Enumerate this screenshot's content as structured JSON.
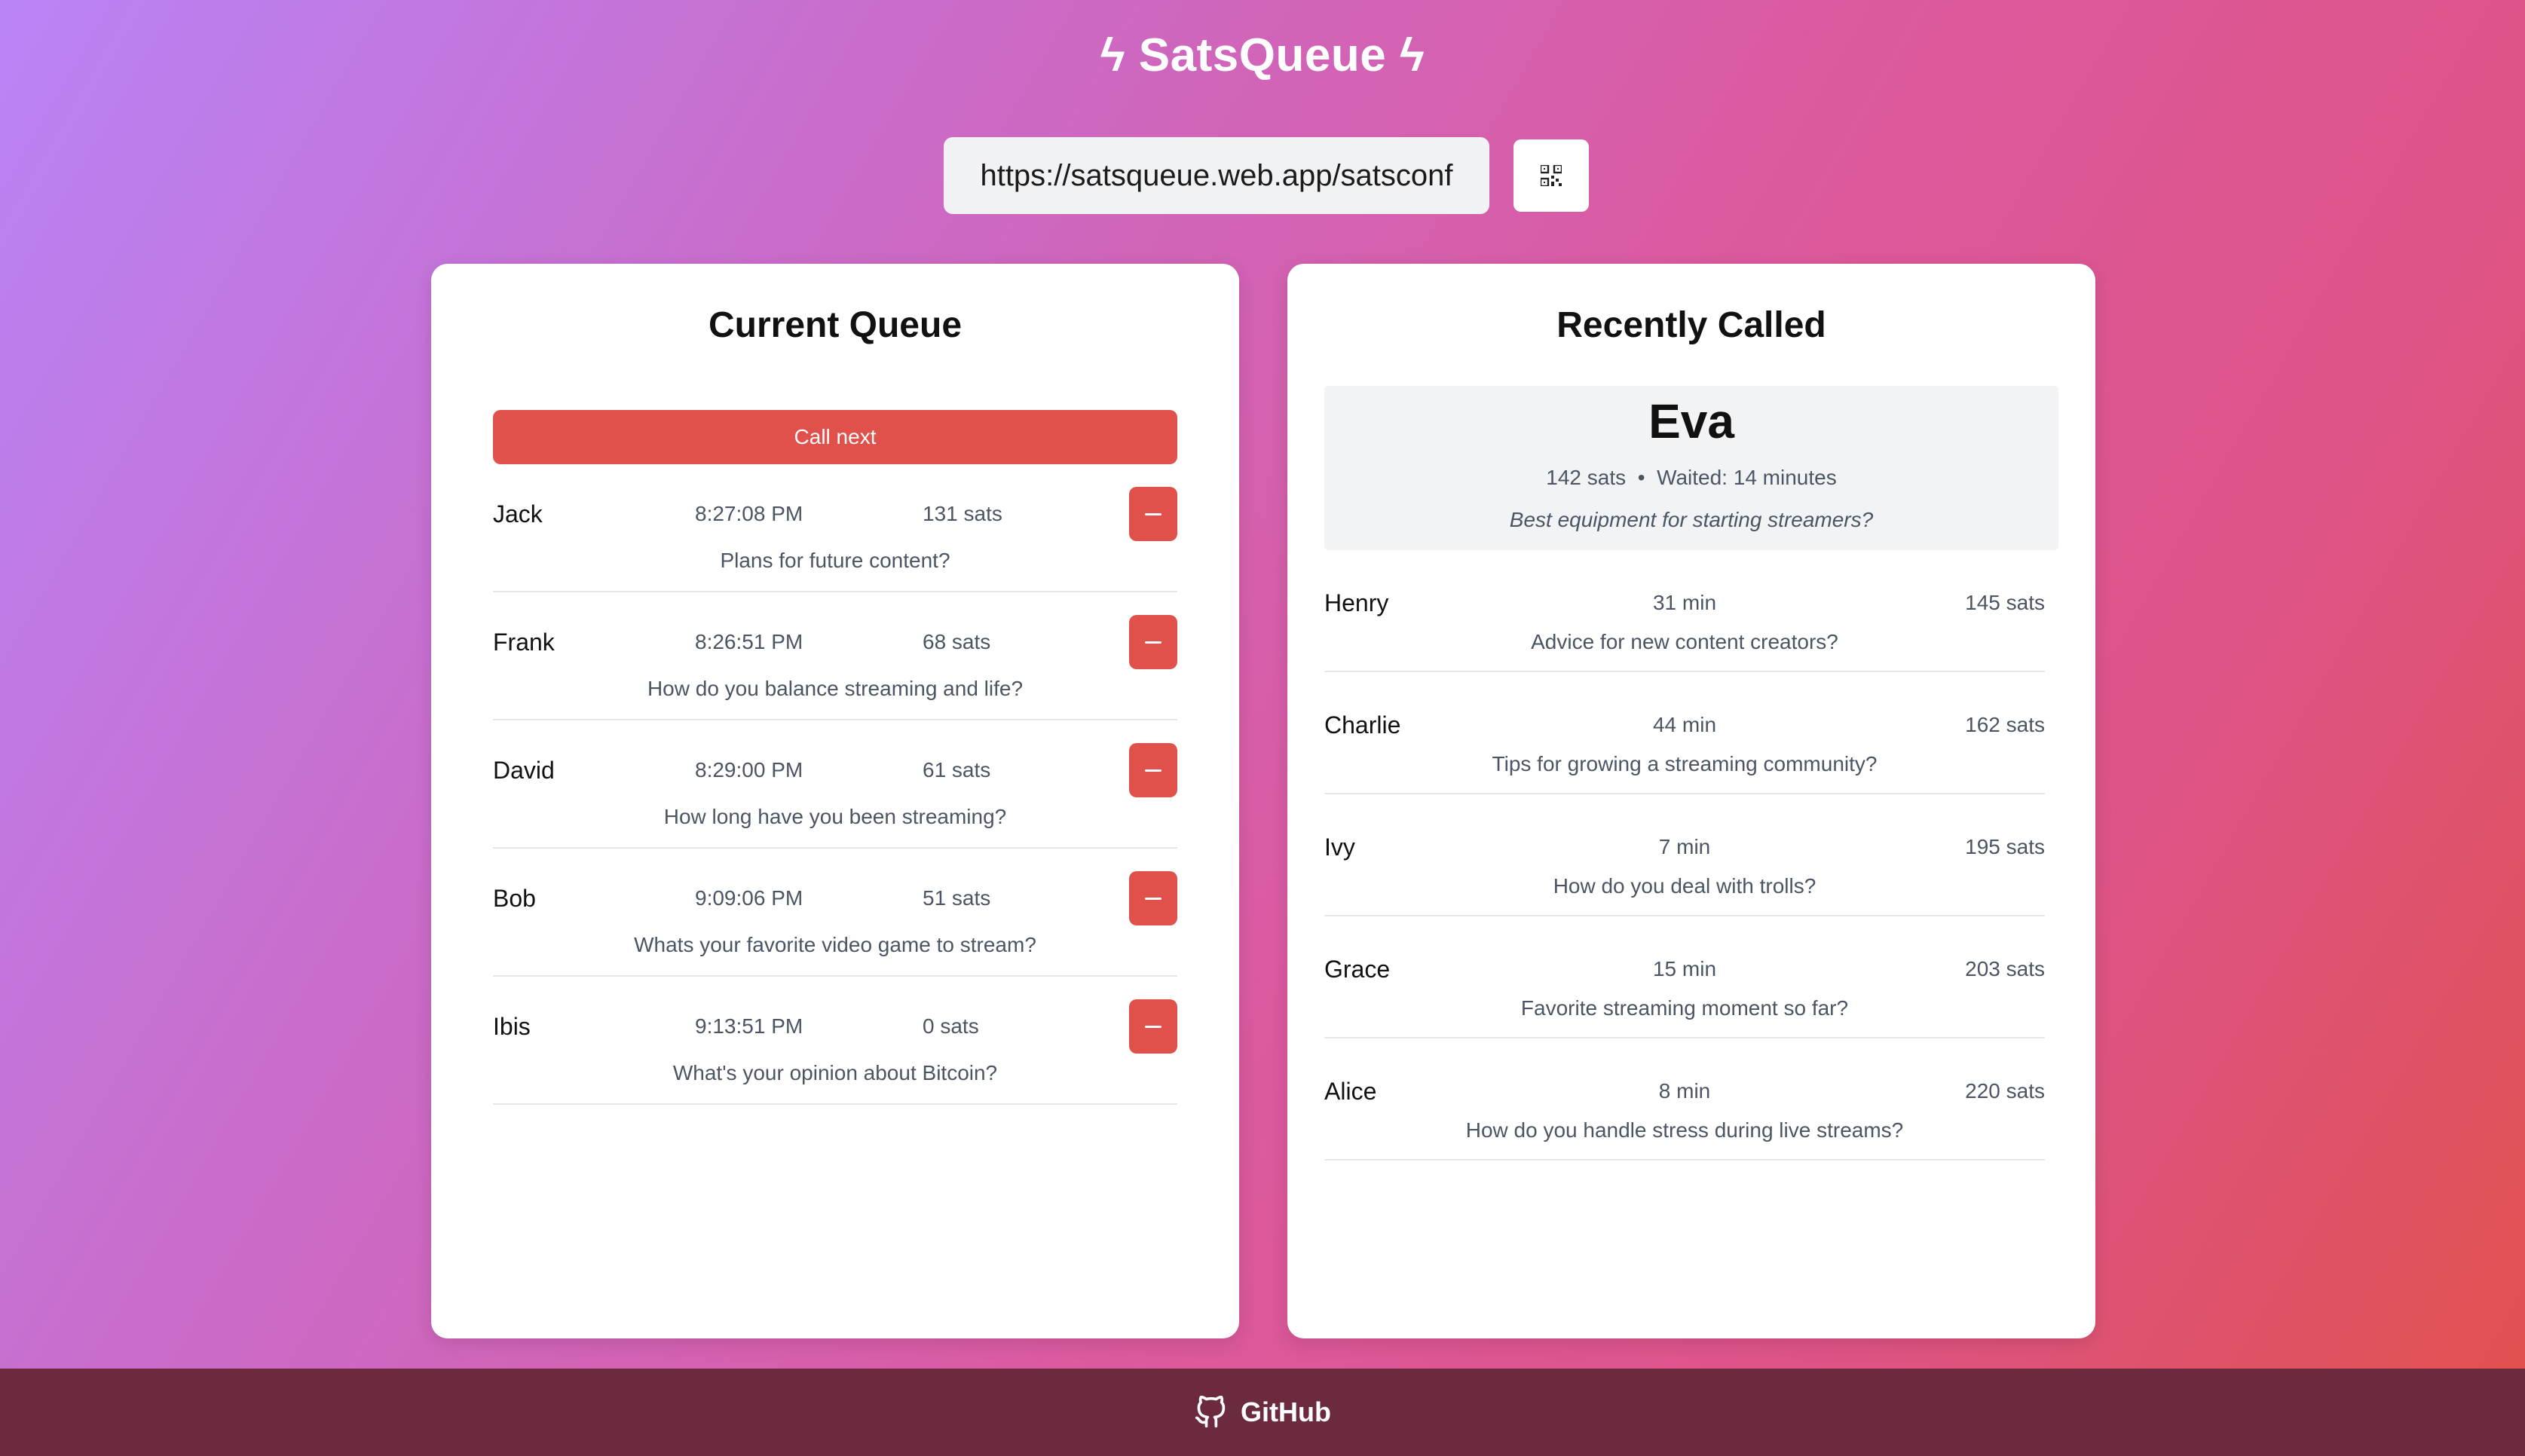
{
  "header": {
    "title": "ϟ SatsQueue ϟ"
  },
  "url_bar": {
    "url": "https://satsqueue.web.app/satsconf",
    "qr_icon": "qr-code-icon"
  },
  "current_queue": {
    "title": "Current Queue",
    "call_next_label": "Call next",
    "remove_icon": "minus-icon",
    "items": [
      {
        "name": "Jack",
        "time": "8:27:08 PM",
        "sats": "131 sats",
        "question": "Plans for future content?"
      },
      {
        "name": "Frank",
        "time": "8:26:51 PM",
        "sats": "68 sats",
        "question": "How do you balance streaming and life?"
      },
      {
        "name": "David",
        "time": "8:29:00 PM",
        "sats": "61 sats",
        "question": "How long have you been streaming?"
      },
      {
        "name": "Bob",
        "time": "9:09:06 PM",
        "sats": "51 sats",
        "question": "Whats your favorite video game to stream?"
      },
      {
        "name": "Ibis",
        "time": "9:13:51 PM",
        "sats": "0 sats",
        "question": "What's your opinion about Bitcoin?"
      }
    ]
  },
  "recently_called": {
    "title": "Recently Called",
    "current": {
      "name": "Eva",
      "sats": "142 sats",
      "separator": "•",
      "waited": "Waited: 14 minutes",
      "question": "Best equipment for starting streamers?"
    },
    "items": [
      {
        "name": "Henry",
        "wait": "31 min",
        "sats": "145 sats",
        "question": "Advice for new content creators?"
      },
      {
        "name": "Charlie",
        "wait": "44 min",
        "sats": "162 sats",
        "question": "Tips for growing a streaming community?"
      },
      {
        "name": "Ivy",
        "wait": "7 min",
        "sats": "195 sats",
        "question": "How do you deal with trolls?"
      },
      {
        "name": "Grace",
        "wait": "15 min",
        "sats": "203 sats",
        "question": "Favorite streaming moment so far?"
      },
      {
        "name": "Alice",
        "wait": "8 min",
        "sats": "220 sats",
        "question": "How do you handle stress during live streams?"
      }
    ]
  },
  "footer": {
    "link_label": "GitHub",
    "icon": "github-icon"
  },
  "colors": {
    "accent_red": "#e0514b",
    "footer_bg": "#6c2a3f"
  }
}
